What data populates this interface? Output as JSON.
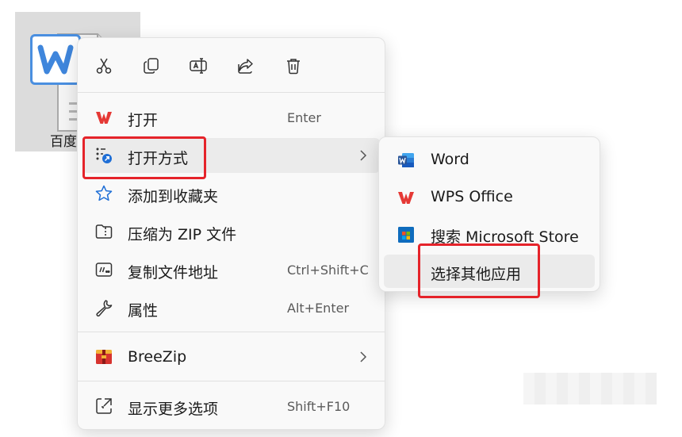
{
  "desktop": {
    "file_name": "百度"
  },
  "toolbar": {
    "buttons": [
      {
        "icon": "scissors-icon",
        "label": "Cut"
      },
      {
        "icon": "copy-icon",
        "label": "Copy"
      },
      {
        "icon": "rename-icon",
        "label": "Rename"
      },
      {
        "icon": "share-icon",
        "label": "Share"
      },
      {
        "icon": "trash-icon",
        "label": "Delete"
      }
    ]
  },
  "menu": {
    "items": [
      {
        "label": "打开",
        "shortcut": "Enter",
        "icon": "wps-icon"
      },
      {
        "label": "打开方式",
        "shortcut": "",
        "icon": "open-with-icon",
        "has_submenu": true
      },
      {
        "label": "添加到收藏夹",
        "shortcut": "",
        "icon": "star-icon"
      },
      {
        "label": "压缩为 ZIP 文件",
        "shortcut": "",
        "icon": "zip-folder-icon"
      },
      {
        "label": "复制文件地址",
        "shortcut": "Ctrl+Shift+C",
        "icon": "copy-path-icon"
      },
      {
        "label": "属性",
        "shortcut": "Alt+Enter",
        "icon": "wrench-icon"
      },
      {
        "label": "BreeZip",
        "shortcut": "",
        "icon": "breezip-icon",
        "has_submenu": true
      },
      {
        "label": "显示更多选项",
        "shortcut": "Shift+F10",
        "icon": "more-options-icon"
      }
    ]
  },
  "submenu": {
    "items": [
      {
        "label": "Word",
        "icon": "word-icon"
      },
      {
        "label": "WPS Office",
        "icon": "wps-icon"
      },
      {
        "label": "搜索 Microsoft Store",
        "icon": "store-icon"
      },
      {
        "label": "选择其他应用",
        "icon": ""
      }
    ]
  },
  "colors": {
    "highlight_red": "#e5232a",
    "wps_red": "#e53935",
    "word_blue": "#2b579a",
    "accent_blue": "#1f6fd6"
  }
}
